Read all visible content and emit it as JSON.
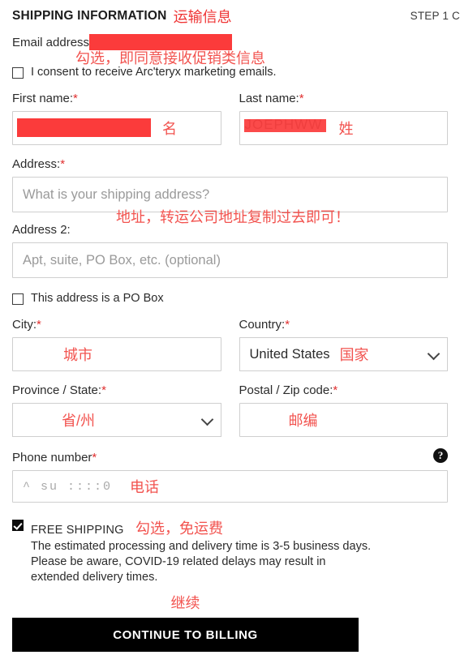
{
  "header": {
    "section_title": "SHIPPING INFORMATION",
    "section_title_note": "运输信息",
    "step": "STEP 1 C"
  },
  "email": {
    "label": "Email address",
    "value_redacted": "",
    "consent_note": "勾选，即同意接收促销类信息",
    "consent_label": "I consent to receive Arc'teryx marketing emails.",
    "consent_checked": false
  },
  "first_name": {
    "label": "First name:",
    "required_mark": "*",
    "value_redacted": "",
    "note": "名"
  },
  "last_name": {
    "label": "Last name:",
    "required_mark": "*",
    "value_obscured": "JOEPHWW",
    "note": "姓"
  },
  "address": {
    "label": "Address:",
    "required_mark": "*",
    "placeholder": "What is your shipping address?",
    "value": "",
    "note": "地址，转运公司地址复制过去即可！"
  },
  "address2": {
    "label": "Address 2:",
    "placeholder": "Apt, suite, PO Box, etc. (optional)",
    "value": ""
  },
  "po_box": {
    "label": "This address is a PO Box",
    "checked": false
  },
  "city": {
    "label": "City:",
    "required_mark": "*",
    "value": "",
    "note": "城市"
  },
  "country": {
    "label": "Country:",
    "required_mark": "*",
    "selected": "United States",
    "note": "国家"
  },
  "province": {
    "label": "Province / State:",
    "required_mark": "*",
    "selected": "",
    "note": "省/州"
  },
  "postal": {
    "label": "Postal / Zip code:",
    "required_mark": "*",
    "value": "",
    "note": "邮编"
  },
  "phone": {
    "label": "Phone number",
    "required_mark": "*",
    "help_icon": "question-mark-icon",
    "value_obscured": "^ su    ::::0",
    "note": "电话"
  },
  "shipping_option": {
    "checked": true,
    "title": "FREE SHIPPING",
    "note": "勾选，免运费",
    "description": "The estimated processing and delivery time is 3-5 business days. Please be aware, COVID-19 related delays may result in extended delivery times."
  },
  "continue": {
    "note": "继续",
    "label": "CONTINUE TO BILLING"
  },
  "colors": {
    "annotation_red": "#f2534f",
    "redaction_red": "#fb3b3b",
    "button_black": "#000000",
    "border_gray": "#cfcfcf",
    "placeholder_gray": "#9a9a9a"
  }
}
